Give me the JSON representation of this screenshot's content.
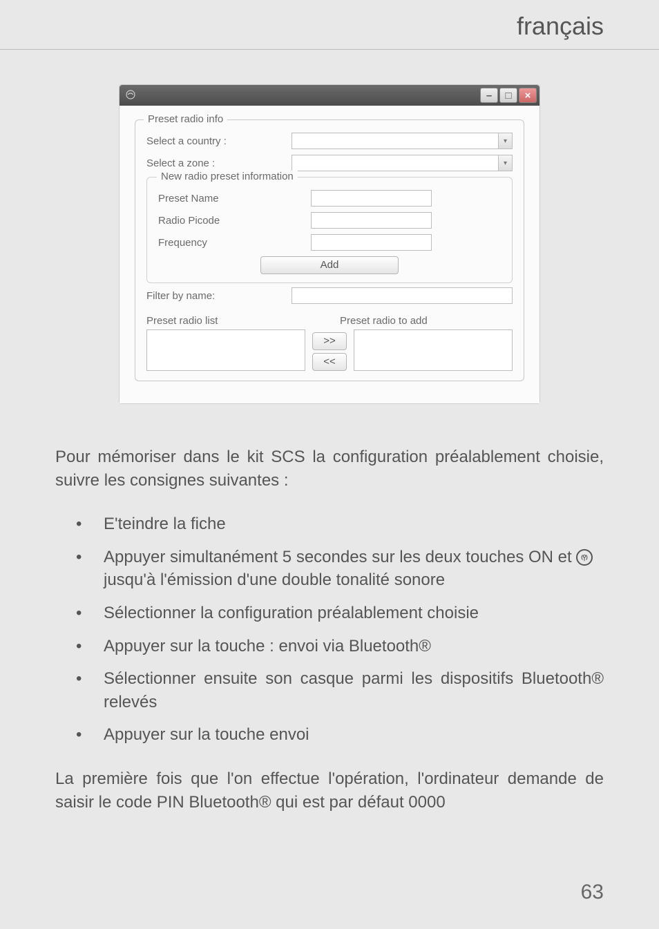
{
  "header": {
    "language": "français"
  },
  "dialog": {
    "groups": {
      "preset_info": {
        "legend": "Preset radio info",
        "select_country_label": "Select a country :",
        "select_zone_label": "Select a zone :"
      },
      "new_preset": {
        "legend": "New radio preset information",
        "preset_name_label": "Preset Name",
        "picode_label": "Radio Picode",
        "frequency_label": "Frequency",
        "add_button": "Add"
      }
    },
    "filter_label": "Filter by name:",
    "list_left_label": "Preset radio list",
    "list_right_label": "Preset radio to add",
    "move_right": ">>",
    "move_left": "<<"
  },
  "body": {
    "intro": "Pour mémoriser dans le kit SCS la configuration préalablement choisie, suivre les consignes suivantes :",
    "bullets": [
      "E'teindre la fiche",
      "Appuyer simultanément 5 secondes sur les deux touches ON et",
      "jusqu'à l'émission d'une double tonalité sonore",
      "Sélectionner la configuration préalablement choisie",
      "Appuyer sur la touche : envoi via Bluetooth®",
      "Sélectionner ensuite son casque parmi les dispositifs Bluetooth® relevés",
      "Appuyer sur la touche envoi"
    ],
    "pin_note": "La première fois que l'on effectue l'opération, l'ordinateur demande de saisir le code PIN Bluetooth® qui est par défaut 0000"
  },
  "page_number": "63"
}
